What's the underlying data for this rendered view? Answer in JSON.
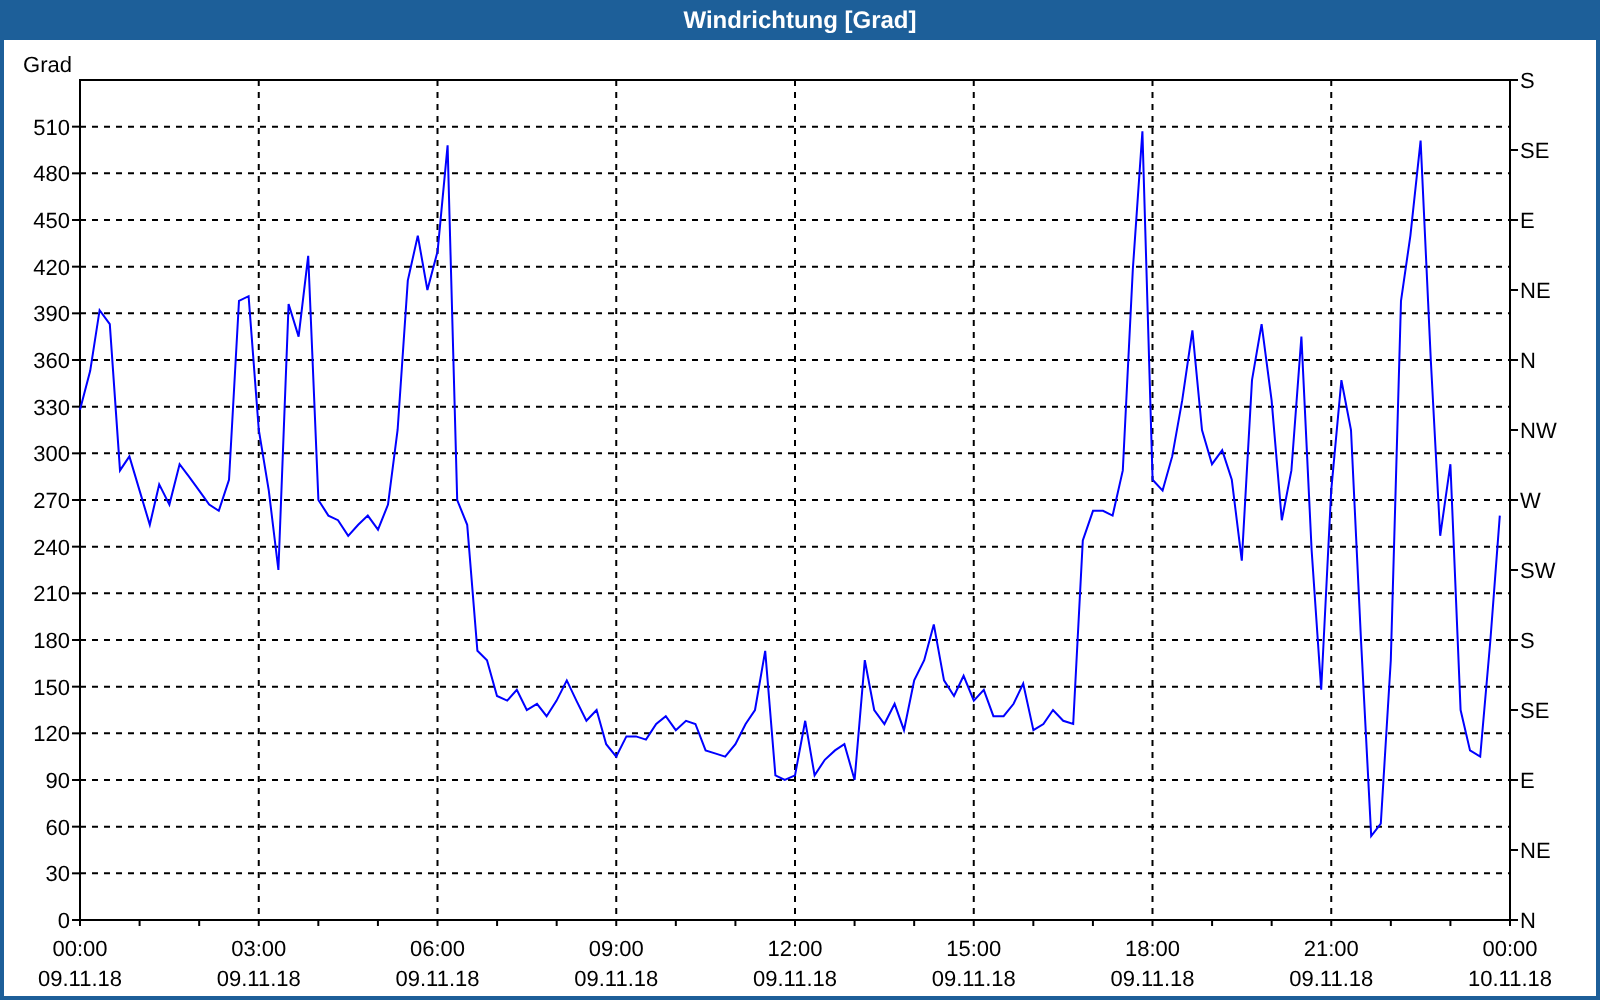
{
  "window": {
    "title": "Windrichtung [Grad]"
  },
  "chart": {
    "right_axis_labels": [
      "S",
      "SE",
      "E",
      "NE",
      "N",
      "NW",
      "W",
      "SW",
      "S",
      "SE",
      "E",
      "NE",
      "N"
    ],
    "date_labels": [
      "09.11.18",
      "09.11.18",
      "09.11.18",
      "09.11.18",
      "09.11.18",
      "09.11.18",
      "09.11.18",
      "09.11.18",
      "10.11.18"
    ],
    "chart_data": {
      "type": "line",
      "ylabel": "Grad",
      "xlim": [
        0,
        24
      ],
      "ylim": [
        0,
        540
      ],
      "yticks": [
        0,
        30,
        60,
        90,
        120,
        150,
        180,
        210,
        240,
        270,
        300,
        330,
        360,
        390,
        420,
        450,
        480,
        510
      ],
      "xticks": [
        {
          "value": 0,
          "label": "00:00"
        },
        {
          "value": 3,
          "label": "03:00"
        },
        {
          "value": 6,
          "label": "06:00"
        },
        {
          "value": 9,
          "label": "09:00"
        },
        {
          "value": 12,
          "label": "12:00"
        },
        {
          "value": 15,
          "label": "15:00"
        },
        {
          "value": 18,
          "label": "18:00"
        },
        {
          "value": 21,
          "label": "21:00"
        },
        {
          "value": 24,
          "label": "00:00"
        }
      ],
      "grid": true,
      "x": [
        0,
        0.17,
        0.33,
        0.5,
        0.67,
        0.83,
        1,
        1.17,
        1.33,
        1.5,
        1.67,
        1.83,
        2,
        2.17,
        2.33,
        2.5,
        2.67,
        2.83,
        3,
        3.17,
        3.33,
        3.5,
        3.67,
        3.83,
        4,
        4.17,
        4.33,
        4.5,
        4.67,
        4.83,
        5,
        5.17,
        5.33,
        5.5,
        5.67,
        5.83,
        6,
        6.17,
        6.33,
        6.5,
        6.67,
        6.83,
        7,
        7.17,
        7.33,
        7.5,
        7.67,
        7.83,
        8,
        8.17,
        8.33,
        8.5,
        8.67,
        8.83,
        9,
        9.17,
        9.33,
        9.5,
        9.67,
        9.83,
        10,
        10.17,
        10.33,
        10.5,
        10.67,
        10.83,
        11,
        11.17,
        11.33,
        11.5,
        11.67,
        11.83,
        12,
        12.17,
        12.33,
        12.5,
        12.67,
        12.83,
        13,
        13.17,
        13.33,
        13.5,
        13.67,
        13.83,
        14,
        14.17,
        14.33,
        14.5,
        14.67,
        14.83,
        15,
        15.17,
        15.33,
        15.5,
        15.67,
        15.83,
        16,
        16.17,
        16.33,
        16.5,
        16.67,
        16.83,
        17,
        17.17,
        17.33,
        17.5,
        17.67,
        17.83,
        18,
        18.17,
        18.33,
        18.5,
        18.67,
        18.83,
        19,
        19.17,
        19.33,
        19.5,
        19.67,
        19.83,
        20,
        20.17,
        20.33,
        20.5,
        20.67,
        20.83,
        21,
        21.17,
        21.33,
        21.5,
        21.67,
        21.83,
        22,
        22.17,
        22.33,
        22.5,
        22.67,
        22.83,
        23,
        23.17,
        23.33,
        23.5,
        23.67,
        23.83
      ],
      "series": [
        {
          "color": "#0000ff",
          "values": [
            328,
            353,
            392,
            383,
            289,
            298,
            276,
            254,
            280,
            267,
            293,
            285,
            276,
            267,
            263,
            283,
            398,
            401,
            315,
            276,
            225,
            396,
            375,
            427,
            270,
            260,
            257,
            247,
            254,
            260,
            251,
            267,
            315,
            411,
            440,
            405,
            430,
            498,
            270,
            254,
            173,
            167,
            144,
            141,
            148,
            135,
            139,
            131,
            141,
            154,
            141,
            128,
            135,
            113,
            105,
            118,
            118,
            116,
            126,
            131,
            122,
            128,
            126,
            109,
            107,
            105,
            113,
            126,
            135,
            173,
            93,
            90,
            93,
            128,
            93,
            103,
            109,
            113,
            90,
            167,
            135,
            126,
            139,
            122,
            154,
            167,
            190,
            154,
            144,
            157,
            141,
            148,
            131,
            131,
            139,
            152,
            122,
            126,
            135,
            128,
            126,
            244,
            263,
            263,
            260,
            289,
            418,
            507,
            283,
            276,
            298,
            334,
            379,
            315,
            293,
            302,
            283,
            231,
            347,
            383,
            334,
            257,
            289,
            375,
            238,
            148,
            276,
            347,
            315,
            180,
            54,
            62,
            167,
            398,
            440,
            501,
            360,
            247,
            293,
            135,
            109,
            105,
            180,
            260
          ]
        }
      ]
    }
  }
}
